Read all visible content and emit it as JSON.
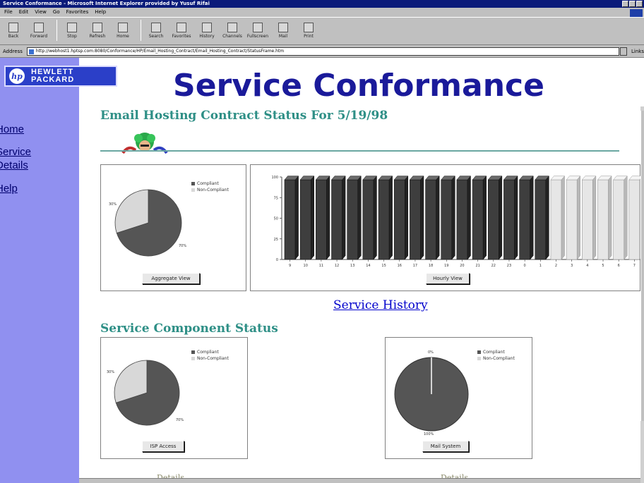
{
  "window": {
    "title": "Service Conformance - Microsoft Internet Explorer provided by Yusuf Rifai"
  },
  "menu": [
    "File",
    "Edit",
    "View",
    "Go",
    "Favorites",
    "Help"
  ],
  "toolbar": {
    "buttons": [
      "Back",
      "Forward",
      "Stop",
      "Refresh",
      "Home",
      "Search",
      "Favorites",
      "History",
      "Channels",
      "Fullscreen",
      "Mail",
      "Print"
    ]
  },
  "address": {
    "label": "Address",
    "value": "http://webhost1.hptsp.com:8080/Conformance/HP/Email_Hosting_Contract/Email_Hosting_Contract/StatusFrame.htm",
    "links_label": "Links"
  },
  "brand": {
    "logo_mark": "hp",
    "logo_line1": "HEWLETT",
    "logo_line2": "PACKARD"
  },
  "page": {
    "title": "Service Conformance",
    "contract_title": "Email Hosting Contract Status For 5/19/98",
    "component_title": "Service Component Status",
    "service_history": "Service History",
    "details_label": "Details"
  },
  "sidebar": {
    "items": [
      {
        "label": "Home"
      },
      {
        "label": "Service",
        "label2": "Details"
      },
      {
        "label": "Help"
      }
    ]
  },
  "colors": {
    "sidebar_bg": "#9090f0",
    "title_blue": "#1a1a9a",
    "heading_teal": "#2e8f86",
    "compliant": "#555555",
    "non_compliant": "#d8d8d8"
  },
  "legend": {
    "compliant": "Compliant",
    "non_compliant": "Non-Compliant"
  },
  "buttons": {
    "aggregate": "Aggregate View",
    "hourly": "Hourly View",
    "isp": "ISP Access",
    "mail": "Mail System"
  },
  "chart_data": [
    {
      "type": "pie",
      "name": "aggregate",
      "categories": [
        "Compliant",
        "Non-Compliant"
      ],
      "values": [
        70,
        30
      ],
      "labels": [
        "70%",
        "30%"
      ]
    },
    {
      "type": "bar",
      "name": "hourly",
      "categories": [
        "9",
        "10",
        "11",
        "12",
        "13",
        "14",
        "15",
        "16",
        "17",
        "18",
        "19",
        "20",
        "21",
        "22",
        "23",
        "0",
        "1",
        "2",
        "3",
        "4",
        "5",
        "6",
        "7"
      ],
      "values": [
        100,
        100,
        100,
        100,
        100,
        100,
        100,
        100,
        100,
        100,
        100,
        100,
        100,
        100,
        100,
        100,
        100,
        100,
        100,
        100,
        100,
        100,
        100
      ],
      "status": [
        "c",
        "c",
        "c",
        "c",
        "c",
        "c",
        "c",
        "c",
        "c",
        "c",
        "c",
        "c",
        "c",
        "c",
        "c",
        "c",
        "c",
        "n",
        "n",
        "n",
        "n",
        "n",
        "n"
      ],
      "yticks": [
        "0",
        "25",
        "50",
        "75",
        "100"
      ],
      "ylim": [
        0,
        100
      ]
    },
    {
      "type": "pie",
      "name": "isp_access",
      "categories": [
        "Compliant",
        "Non-Compliant"
      ],
      "values": [
        70,
        30
      ],
      "labels": [
        "70%",
        "30%"
      ]
    },
    {
      "type": "pie",
      "name": "mail_system",
      "categories": [
        "Compliant",
        "Non-Compliant"
      ],
      "values": [
        100,
        0
      ],
      "labels": [
        "100%",
        "0%"
      ]
    }
  ]
}
